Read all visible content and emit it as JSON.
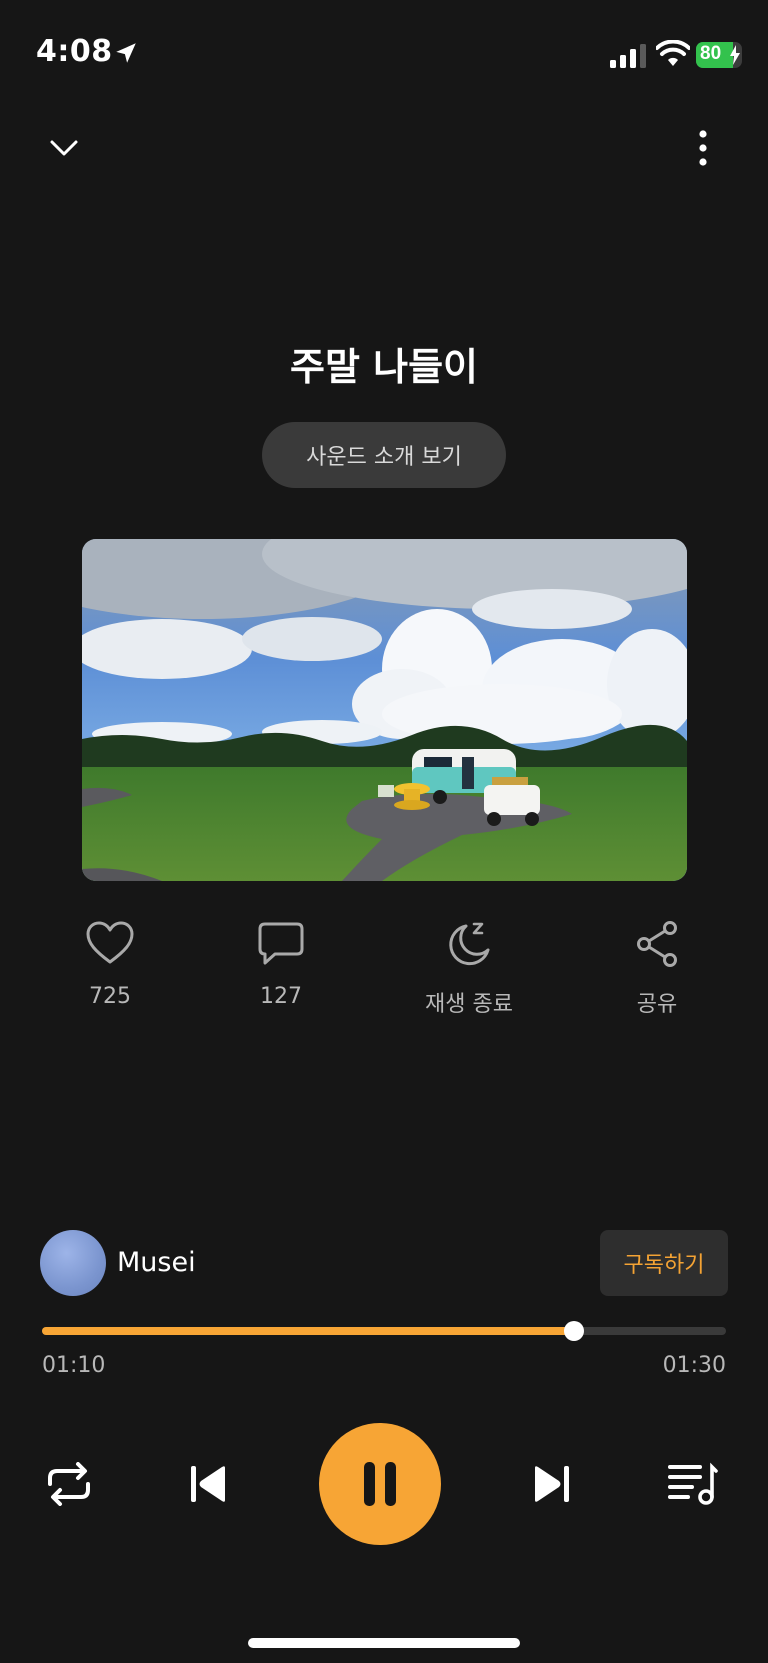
{
  "status_bar": {
    "time": "4:08",
    "battery": "80"
  },
  "header": {
    "collapse_icon": "chevron-down-icon",
    "more_icon": "more-vertical-icon"
  },
  "track": {
    "title": "주말 나들이",
    "intro_button": "사운드 소개 보기"
  },
  "actions": {
    "likes": "725",
    "comments": "127",
    "sleep_timer": "재생 종료",
    "share": "공유"
  },
  "artist": {
    "name": "Musei",
    "subscribe": "구독하기"
  },
  "progress": {
    "current": "01:10",
    "total": "01:30",
    "fraction": 0.778
  },
  "colors": {
    "accent": "#f7a535",
    "background": "#161616"
  }
}
